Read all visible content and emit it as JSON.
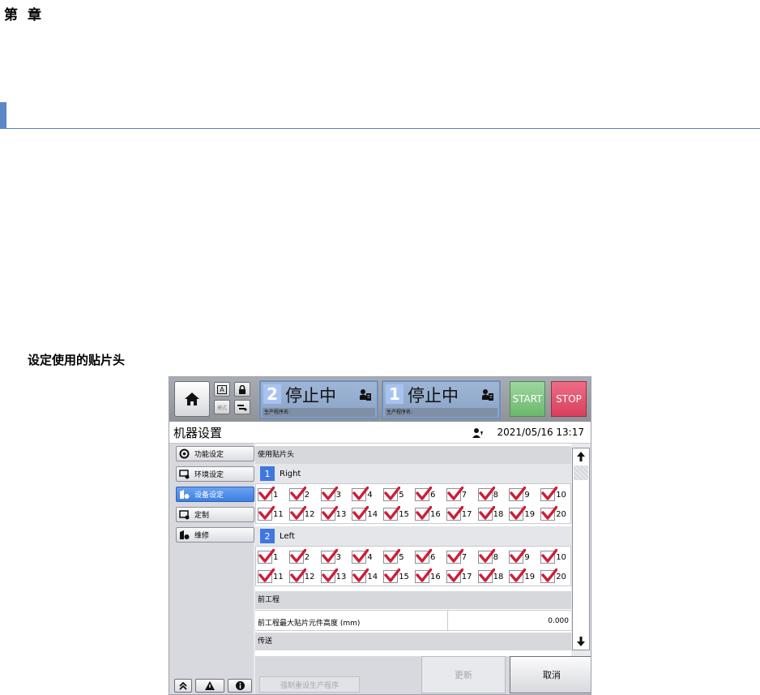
{
  "document": {
    "chapter_char_1": "第",
    "chapter_char_2": "章",
    "section_heading": "设定使用的贴片头"
  },
  "topbar": {
    "home_icon": "home-icon",
    "small_buttons": [
      {
        "name": "a-icon",
        "label": "A"
      },
      {
        "name": "lock-icon",
        "label": ""
      },
      {
        "name": "simulate-icon",
        "label": "模式"
      },
      {
        "name": "conveyor-icon",
        "label": ""
      }
    ],
    "lanes": [
      {
        "number": "2",
        "status": "停止中",
        "program_label": "生产程序名:"
      },
      {
        "number": "1",
        "status": "停止中",
        "program_label": "生产程序名:"
      }
    ],
    "start_label": "START",
    "stop_label": "STOP"
  },
  "header": {
    "title": "机器设置",
    "datetime": "2021/05/16 13:17"
  },
  "sidebar": {
    "items": [
      {
        "label": "功能设定",
        "active": false
      },
      {
        "label": "环境设定",
        "active": false
      },
      {
        "label": "设备设定",
        "active": true
      },
      {
        "label": "定制",
        "active": false
      },
      {
        "label": "维修",
        "active": false
      }
    ]
  },
  "main": {
    "use_heads_section": "使用贴片头",
    "right": {
      "badge": "1",
      "name": "Right",
      "heads": [
        "1",
        "2",
        "3",
        "4",
        "5",
        "6",
        "7",
        "8",
        "9",
        "10",
        "11",
        "12",
        "13",
        "14",
        "15",
        "16",
        "17",
        "18",
        "19",
        "20"
      ]
    },
    "left": {
      "badge": "2",
      "name": "Left",
      "heads": [
        "1",
        "2",
        "3",
        "4",
        "5",
        "6",
        "7",
        "8",
        "9",
        "10",
        "11",
        "12",
        "13",
        "14",
        "15",
        "16",
        "17",
        "18",
        "19",
        "20"
      ]
    },
    "pre_process_section": "前工程",
    "pre_process_label": "前工程最大贴片元件高度 (mm)",
    "pre_process_value": "0.000",
    "transfer_section": "传送"
  },
  "footer": {
    "force_reset_label": "强制重设生产程序",
    "update_label": "更新",
    "cancel_label": "取消"
  },
  "colors": {
    "active_blue": "#3f7fe0",
    "check_red": "#cc1f38",
    "start_green": "#6cb86c",
    "stop_red": "#d8405d"
  }
}
